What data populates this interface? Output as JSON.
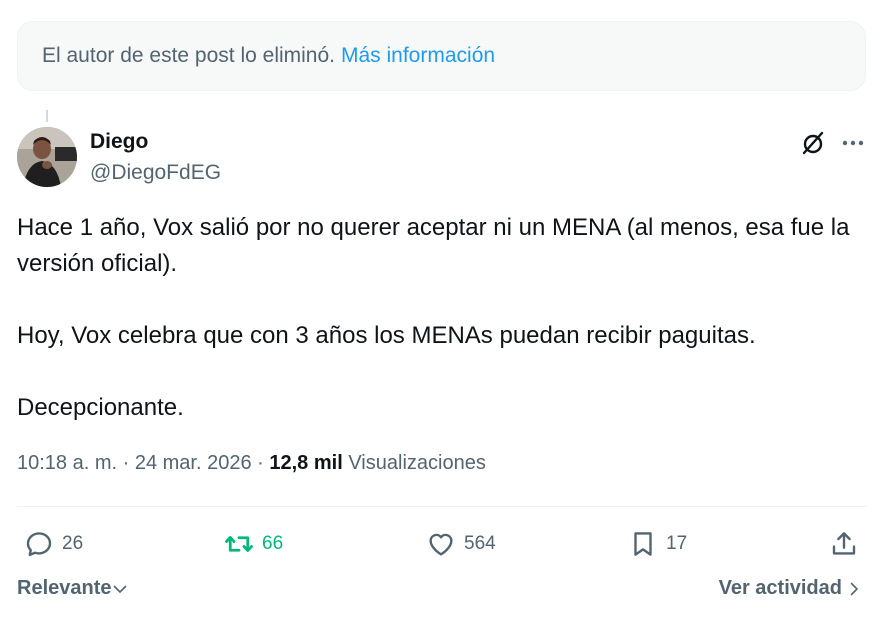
{
  "deleted_notice": {
    "text": "El autor de este post lo eliminó.",
    "link": "Más información"
  },
  "author": {
    "name": "Diego",
    "handle": "@DiegoFdEG"
  },
  "tweet": {
    "paragraph_1": "Hace 1 año, Vox salió por no querer aceptar ni un MENA (al menos, esa fue la versión oficial).",
    "paragraph_2": "Hoy, Vox celebra que con 3 años los MENAs puedan recibir paguitas.",
    "paragraph_3": "Decepcionante."
  },
  "meta": {
    "time": "10:18 a. m.",
    "separator": " · ",
    "date": "24 mar. 2026",
    "views_count": "12,8 mil",
    "views_label": "Visualizaciones"
  },
  "actions": {
    "replies": "26",
    "reposts": "66",
    "likes": "564",
    "bookmarks": "17"
  },
  "footer": {
    "sort_label": "Relevante",
    "activity_label": "Ver actividad"
  },
  "colors": {
    "accent": "#1d9bf0",
    "repost": "#00ba7c",
    "secondary_text": "#536471",
    "primary_text": "#0f1419"
  }
}
